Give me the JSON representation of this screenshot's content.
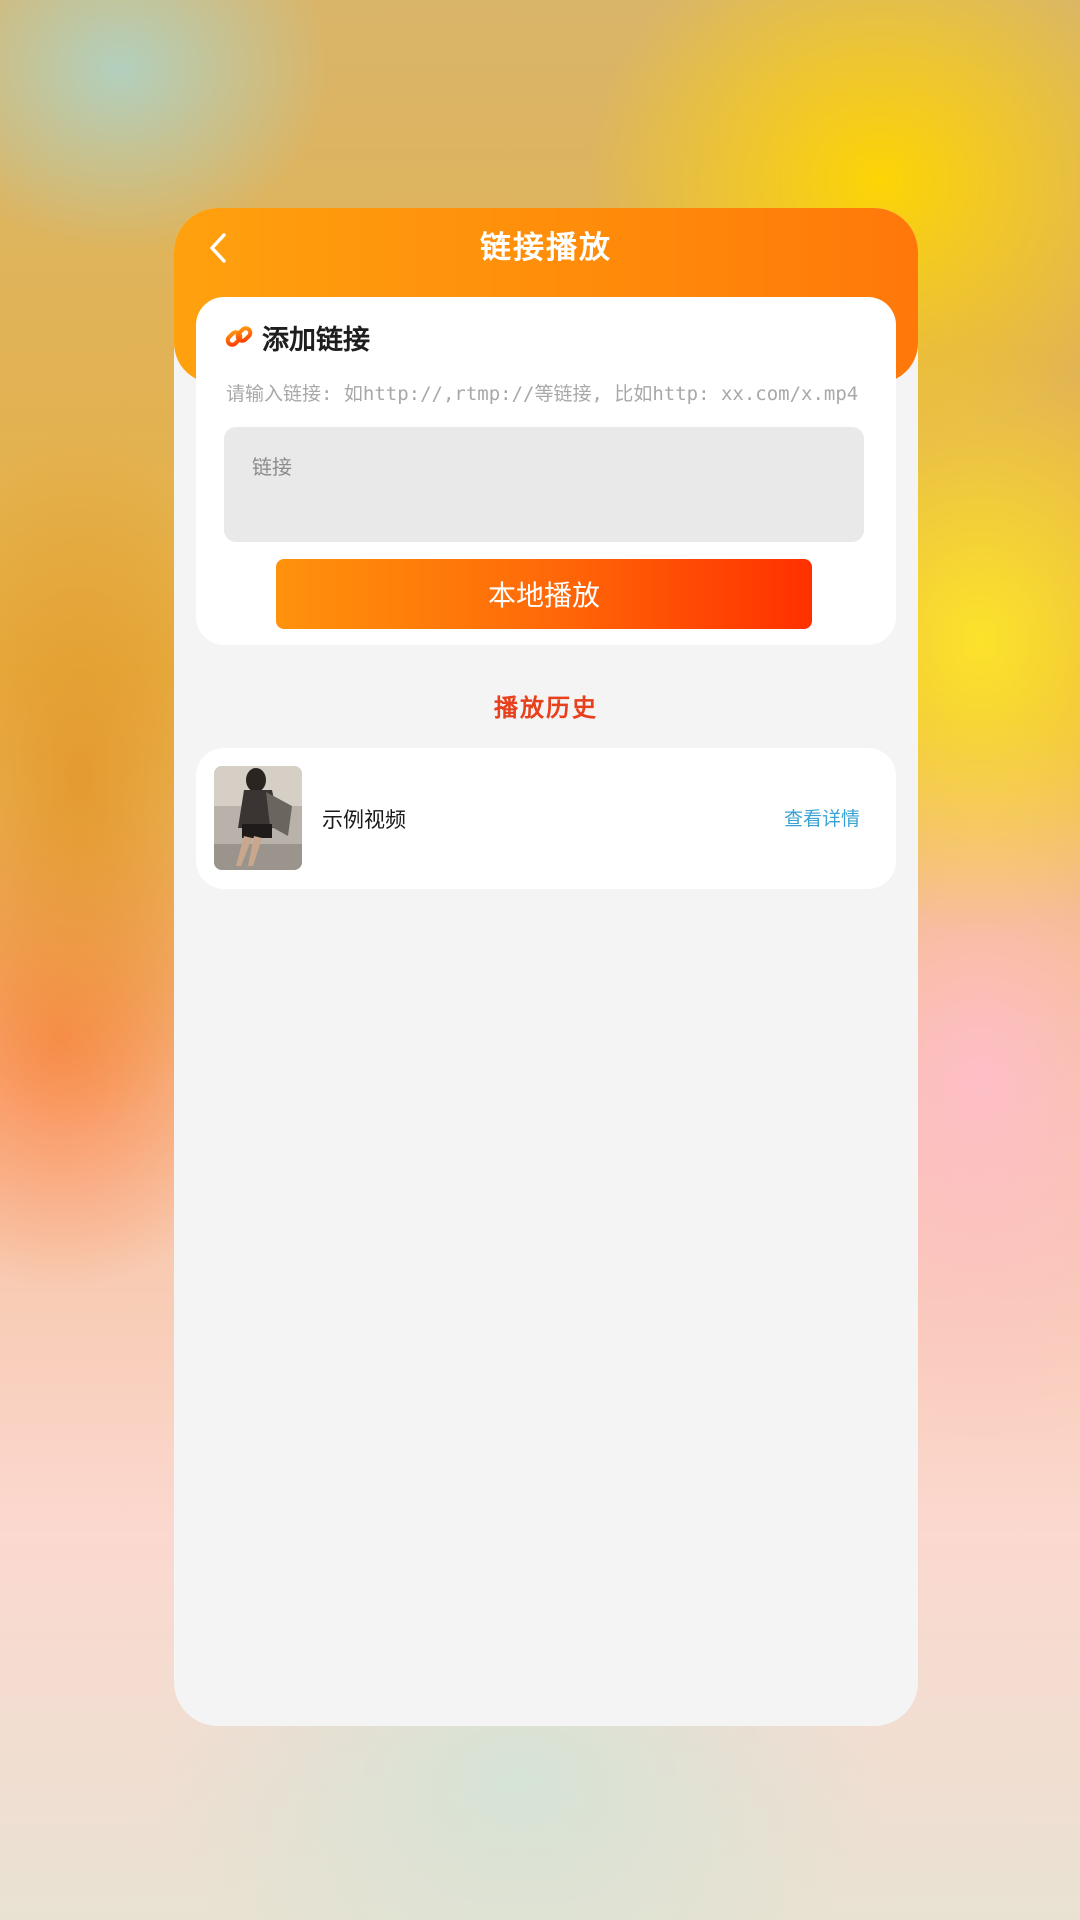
{
  "header": {
    "title": "链接播放",
    "back_icon": "chevron-left-icon"
  },
  "add_link": {
    "icon": "link-icon",
    "title": "添加链接",
    "hint": "请输入链接: 如http://,rtmp://等链接, 比如http: xx.com/x.mp4",
    "input_placeholder": "链接",
    "input_value": "",
    "button_label": "本地播放"
  },
  "history": {
    "title": "播放历史",
    "items": [
      {
        "title": "示例视频",
        "detail_label": "查看详情"
      }
    ]
  },
  "colors": {
    "header_orange": "#ff8a0a",
    "button_gradient_start": "#ff920c",
    "button_gradient_end": "#ff3000",
    "history_title": "#e8401c",
    "detail_link": "#3aa3d4"
  }
}
